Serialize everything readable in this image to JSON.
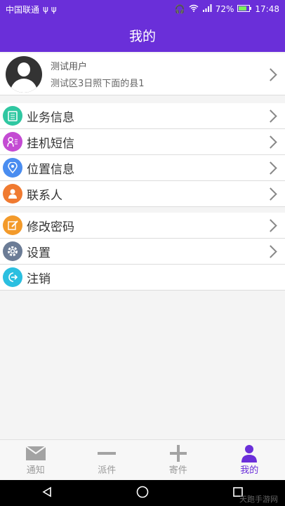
{
  "status_bar": {
    "carrier": "中国联通",
    "battery": "72%",
    "time": "17:48"
  },
  "header": {
    "title": "我的"
  },
  "profile": {
    "name": "测试用户",
    "subtitle": "测试区3日照下面的县1"
  },
  "menu": [
    {
      "label": "业务信息",
      "icon": "clipboard-icon",
      "color": "#2fc7a1"
    },
    {
      "label": "挂机短信",
      "icon": "sms-icon",
      "color": "#c44bd3"
    },
    {
      "label": "位置信息",
      "icon": "location-icon",
      "color": "#4a8df0"
    },
    {
      "label": "联系人",
      "icon": "contact-icon",
      "color": "#f07a30"
    },
    {
      "label": "修改密码",
      "icon": "edit-icon",
      "color": "#f39a2a"
    },
    {
      "label": "设置",
      "icon": "gear-icon",
      "color": "#6b7c96"
    },
    {
      "label": "注销",
      "icon": "logout-icon",
      "color": "#2bbfe0"
    }
  ],
  "tabs": [
    {
      "label": "通知",
      "icon": "mail-icon"
    },
    {
      "label": "派件",
      "icon": "minus-icon"
    },
    {
      "label": "寄件",
      "icon": "plus-icon"
    },
    {
      "label": "我的",
      "icon": "person-icon",
      "active": true
    }
  ],
  "accent_color": "#6a2fd9",
  "watermark": "天跑手游网"
}
